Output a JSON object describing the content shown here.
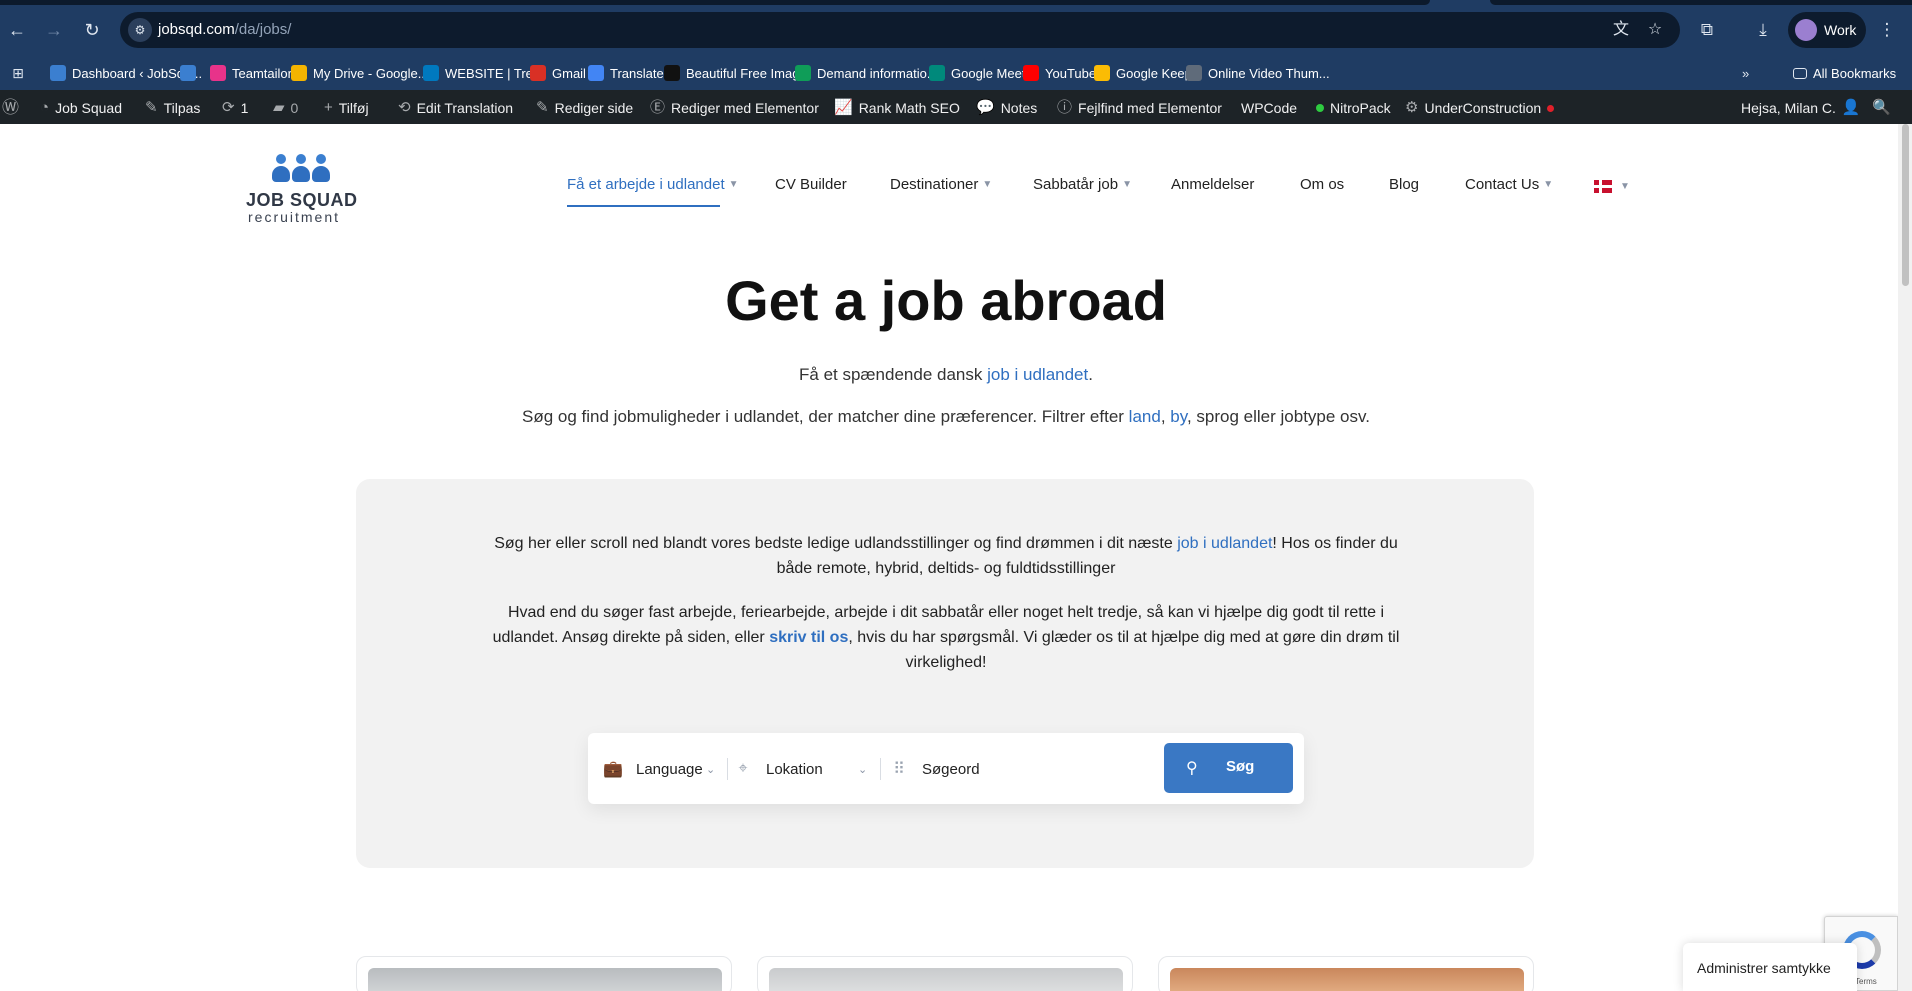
{
  "browser": {
    "url_host": "jobsqd.com",
    "url_path": "/da/jobs/",
    "profile_label": "Work"
  },
  "bookmarks": [
    {
      "label": "Dashboard ‹ JobSqu...",
      "color": "#3b7fd0"
    },
    {
      "label": "",
      "color": "#3b7fd0"
    },
    {
      "label": "Teamtailor",
      "color": "#e8338a"
    },
    {
      "label": "My Drive - Google...",
      "color": "#f4b400"
    },
    {
      "label": "WEBSITE | Trello",
      "color": "#0079bf"
    },
    {
      "label": "Gmail",
      "color": "#d93025"
    },
    {
      "label": "Translate",
      "color": "#4285f4"
    },
    {
      "label": "Beautiful Free Imag...",
      "color": "#111111"
    },
    {
      "label": "Demand informatio...",
      "color": "#0f9d58"
    },
    {
      "label": "Google Meet",
      "color": "#00897b"
    },
    {
      "label": "YouTube",
      "color": "#ff0000"
    },
    {
      "label": "Google Keep",
      "color": "#fbbc04"
    },
    {
      "label": "Online Video Thum...",
      "color": "#5f6b7a"
    }
  ],
  "all_bookmarks_label": "All Bookmarks",
  "adminbar": {
    "site": "Job Squad",
    "customize": "Tilpas",
    "updates": "1",
    "comments": "0",
    "new": "Tilføj",
    "edit_translation": "Edit Translation",
    "edit_page": "Rediger side",
    "elementor": "Rediger med Elementor",
    "rankmath": "Rank Math SEO",
    "notes": "Notes",
    "debug": "Fejlfind med Elementor",
    "wpcode": "WPCode",
    "nitropack": "NitroPack",
    "underconstruction": "UnderConstruction",
    "user": "Hejsa, Milan C."
  },
  "logo": {
    "name": "JOB SQUAD",
    "sub": "recruitment"
  },
  "nav": [
    "Få et arbejde i udlandet",
    "CV Builder",
    "Destinationer",
    "Sabbatår job",
    "Anmeldelser",
    "Om os",
    "Blog",
    "Contact Us"
  ],
  "hero": {
    "title": "Get a job abroad",
    "sub1_pre": "Få et spændende dansk ",
    "sub1_link": "job i udlandet",
    "sub1_post": ".",
    "sub2_pre": "Søg og find jobmuligheder i udlandet, der matcher dine præferencer. Filtrer efter ",
    "sub2_link1": "land",
    "sub2_mid": ", ",
    "sub2_link2": "by",
    "sub2_post": ", sprog eller jobtype osv."
  },
  "intro": {
    "p1_pre": "Søg her eller scroll ned blandt vores bedste ledige udlandsstillinger og find drømmen i dit næste ",
    "p1_link": "job i udlandet",
    "p1_post": "! Hos os finder du både remote, hybrid, deltids- og fuldtidsstillinger",
    "p2_pre": "Hvad end du søger fast arbejde, feriearbejde, arbejde i dit sabbatår eller noget helt tredje, så kan vi hjælpe dig godt til rette i udlandet. Ansøg direkte på siden, eller ",
    "p2_link": "skriv til os",
    "p2_post": ", hvis du har spørgsmål. Vi glæder os til at hjælpe dig med at gøre din drøm til virkelighed!"
  },
  "search": {
    "language": "Language",
    "location": "Lokation",
    "keyword": "Søgeord",
    "button": "Søg"
  },
  "consent_label": "Administrer samtykke",
  "recaptcha_terms": "Terms",
  "colors": {
    "accent": "#2f6fc0",
    "chrome": "#1f3c63",
    "adminbar": "#1d2327"
  }
}
